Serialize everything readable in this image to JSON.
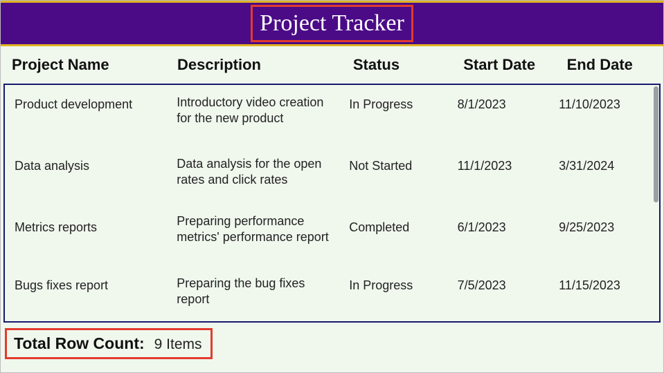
{
  "title": "Project Tracker",
  "columns": {
    "name": "Project Name",
    "desc": "Description",
    "status": "Status",
    "start": "Start Date",
    "end": "End Date"
  },
  "rows": [
    {
      "name": "Product development",
      "desc": "Introductory video creation for the new product",
      "status": "In Progress",
      "start": "8/1/2023",
      "end": "11/10/2023"
    },
    {
      "name": "Data analysis",
      "desc": "Data analysis for the open rates and click rates",
      "status": "Not Started",
      "start": "11/1/2023",
      "end": "3/31/2024"
    },
    {
      "name": "Metrics reports",
      "desc": "Preparing performance metrics' performance report",
      "status": "Completed",
      "start": "6/1/2023",
      "end": "9/25/2023"
    },
    {
      "name": "Bugs fixes report",
      "desc": "Preparing the bug fixes report",
      "status": "In Progress",
      "start": "7/5/2023",
      "end": "11/15/2023"
    }
  ],
  "footer": {
    "label": "Total Row Count:",
    "value": "9 Items"
  }
}
